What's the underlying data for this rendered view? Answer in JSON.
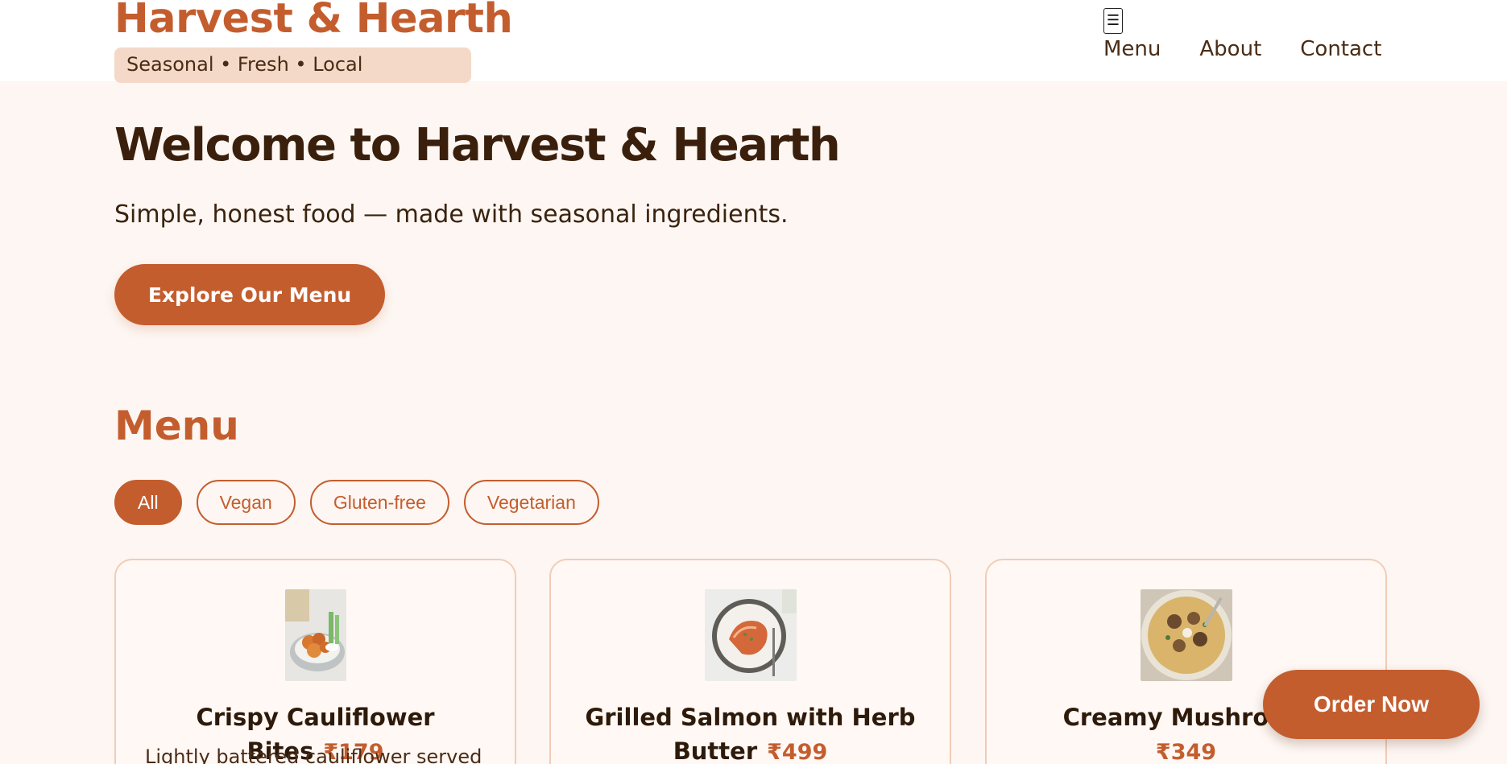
{
  "brand": {
    "title": "Harvest & Hearth",
    "tagline": "Seasonal • Fresh • Local"
  },
  "nav": {
    "toggle_icon": "hamburger-icon",
    "items": [
      "Menu",
      "About",
      "Contact"
    ]
  },
  "hero": {
    "title": "Welcome to Harvest & Hearth",
    "subtitle": "Simple, honest food — made with seasonal ingredients.",
    "cta_label": "Explore Our Menu"
  },
  "menu": {
    "title": "Menu",
    "filters": [
      {
        "label": "All",
        "active": true
      },
      {
        "label": "Vegan",
        "active": false
      },
      {
        "label": "Gluten-free",
        "active": false
      },
      {
        "label": "Vegetarian",
        "active": false
      }
    ],
    "items": [
      {
        "name": "Crispy Cauliflower Bites",
        "price": "₹179",
        "description": "Lightly battered cauliflower served",
        "image": "cauliflower-bites-photo"
      },
      {
        "name": "Grilled Salmon with Herb Butter",
        "price": "₹499",
        "description": "",
        "image": "grilled-salmon-photo"
      },
      {
        "name": "Creamy Mushroom",
        "price": "₹349",
        "description": "",
        "image": "mushroom-pasta-photo"
      }
    ]
  },
  "order_button_label": "Order Now",
  "colors": {
    "accent": "#c45d2e",
    "background": "#fdf6f2",
    "tag_bg": "#f4d9c8",
    "text_dark": "#3a200c"
  }
}
